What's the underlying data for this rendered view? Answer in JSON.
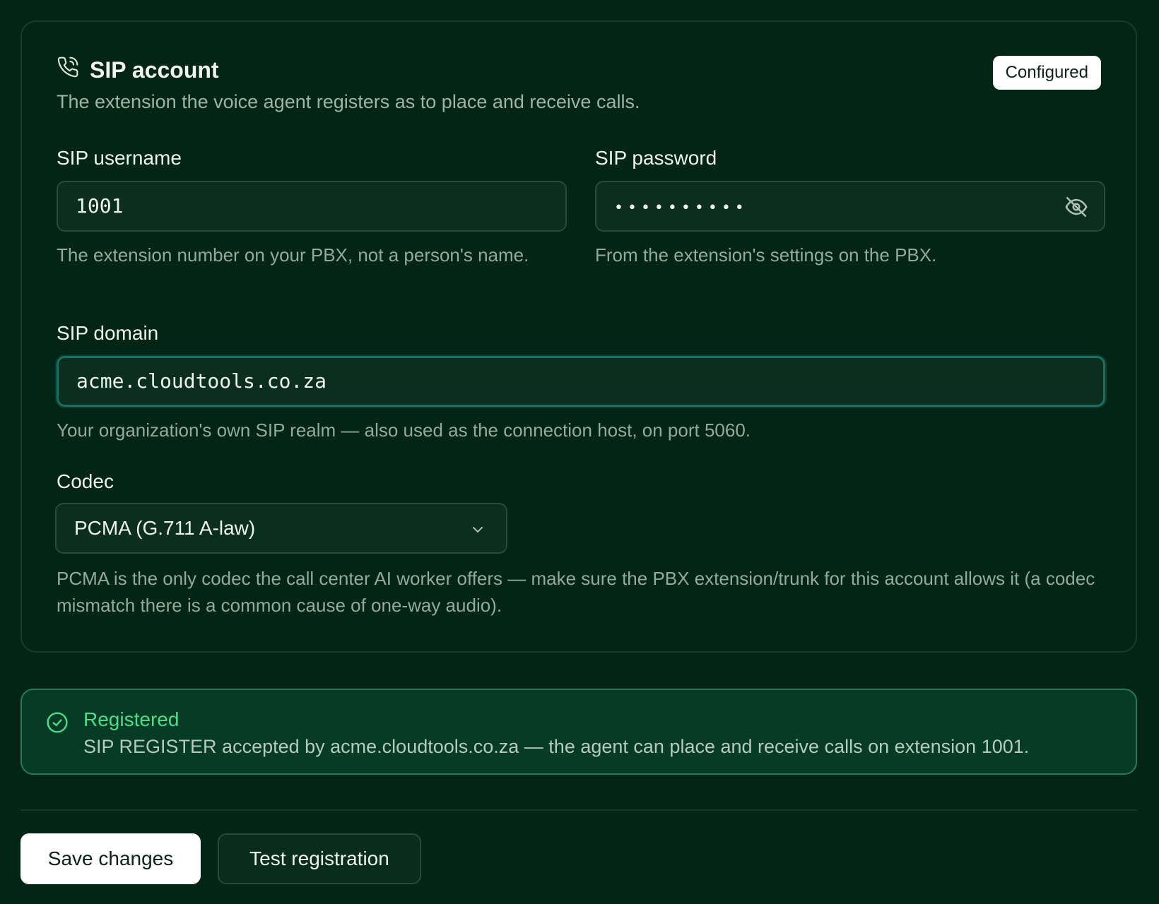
{
  "card": {
    "title": "SIP account",
    "description": "The extension the voice agent registers as to place and receive calls.",
    "badge": "Configured"
  },
  "fields": {
    "username": {
      "label": "SIP username",
      "value": "1001",
      "help": "The extension number on your PBX, not a person's name."
    },
    "password": {
      "label": "SIP password",
      "value": "••••••••••",
      "help": "From the extension's settings on the PBX."
    },
    "domain": {
      "label": "SIP domain",
      "value": "acme.cloudtools.co.za",
      "help": "Your organization's own SIP realm — also used as the connection host, on port 5060."
    },
    "codec": {
      "label": "Codec",
      "value": "PCMA (G.711 A-law)",
      "help": "PCMA is the only codec the call center AI worker offers — make sure the PBX extension/trunk for this account allows it (a codec mismatch there is a common cause of one-way audio)."
    }
  },
  "status": {
    "title": "Registered",
    "message": "SIP REGISTER accepted by acme.cloudtools.co.za — the agent can place and receive calls on extension 1001."
  },
  "actions": {
    "save_label": "Save changes",
    "test_label": "Test registration"
  },
  "icons": {
    "card_icon": "phone-icon",
    "password_toggle": "eye-off-icon",
    "select_indicator": "chevron-down-icon",
    "status_icon": "check-circle-icon"
  },
  "colors": {
    "background": "#022515",
    "success": "#4ade8a",
    "focus_ring": "#1a6e60"
  }
}
